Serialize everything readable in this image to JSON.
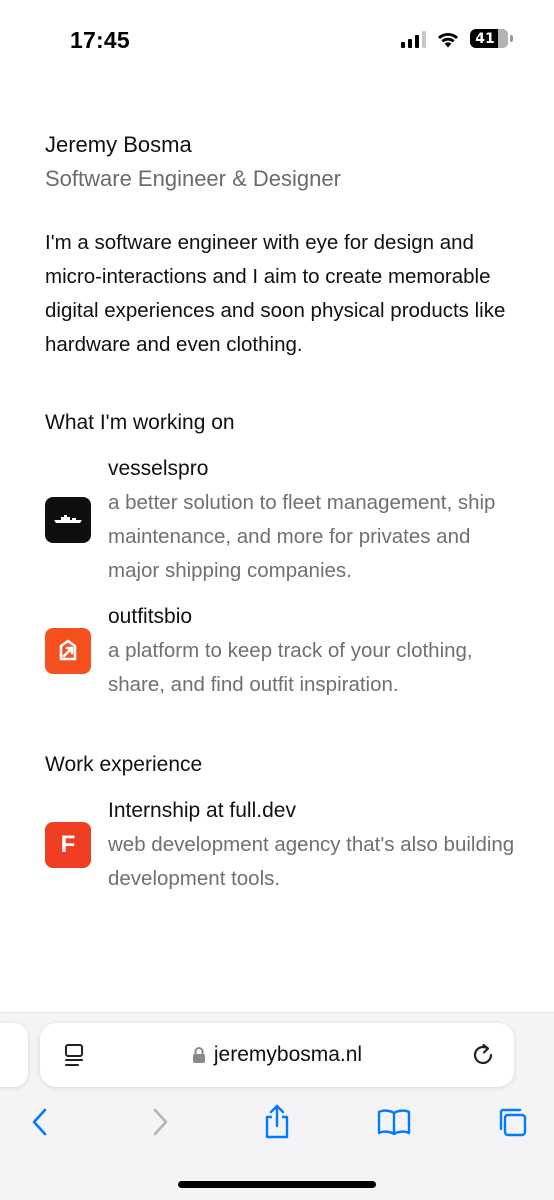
{
  "status_bar": {
    "time": "17:45",
    "battery_level": "41",
    "icons": [
      "cellular-signal-icon",
      "wifi-icon",
      "battery-icon"
    ]
  },
  "profile": {
    "name": "Jeremy Bosma",
    "role": "Software Engineer & Designer",
    "bio": "I'm a software engineer with eye for design and micro-interactions and I aim to create memorable digital experiences and soon physical products like hardware and even clothing."
  },
  "working_on": {
    "title": "What I'm working on",
    "items": [
      {
        "name": "vesselspro",
        "description": "a better solution to fleet management, ship maintenance, and more for privates and major shipping companies.",
        "icon": "ship-logo-icon"
      },
      {
        "name": "outfitsbio",
        "description": "a platform to keep track of your clothing, share, and find outfit inspiration.",
        "icon": "outfitsbio-logo-icon"
      }
    ]
  },
  "work_experience": {
    "title": "Work experience",
    "items": [
      {
        "name": "Internship at full.dev",
        "description": "web development agency that's also building development tools.",
        "logo_letter": "F",
        "icon": "full-dev-logo-icon"
      }
    ]
  },
  "browser": {
    "url": "jeremybosma.nl",
    "icons": [
      "reader-icon",
      "lock-icon",
      "reload-icon",
      "back-icon",
      "forward-icon",
      "share-icon",
      "bookmarks-icon",
      "tabs-icon"
    ]
  },
  "colors": {
    "accent": "#007aff",
    "muted_text": "#707070",
    "outfitsbio_brand": "#f4511e",
    "fulldev_brand": "#ef3e22"
  }
}
